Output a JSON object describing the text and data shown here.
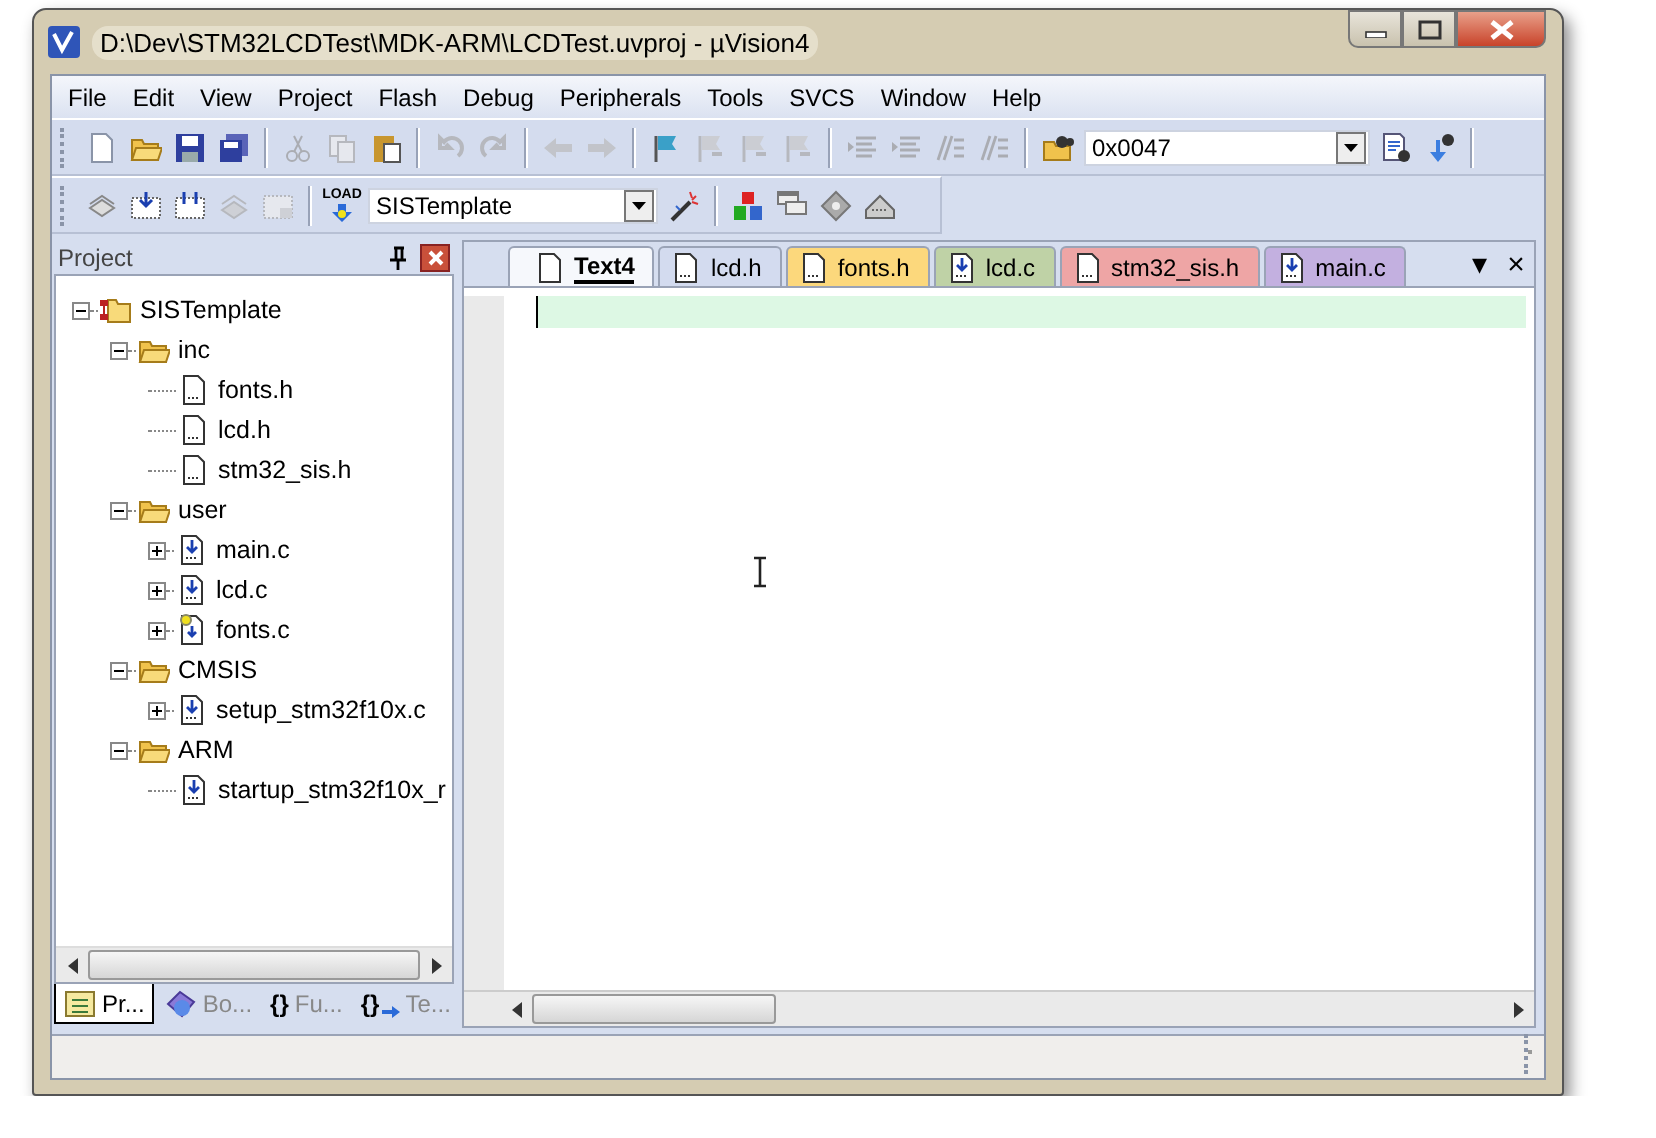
{
  "window": {
    "title": "D:\\Dev\\STM32LCDTest\\MDK-ARM\\LCDTest.uvproj - µVision4"
  },
  "menu": [
    "File",
    "Edit",
    "View",
    "Project",
    "Flash",
    "Debug",
    "Peripherals",
    "Tools",
    "SVCS",
    "Window",
    "Help"
  ],
  "toolbar_1": {
    "combo_value": "0x0047"
  },
  "toolbar_2": {
    "load_label": "LOAD",
    "combo_value": "SISTemplate"
  },
  "project_panel": {
    "title": "Project",
    "tree": [
      {
        "label": "SISTemplate",
        "kind": "project",
        "expanded": true,
        "children": [
          {
            "label": "inc",
            "kind": "group",
            "expanded": true,
            "children": [
              {
                "label": "fonts.h",
                "kind": "header"
              },
              {
                "label": "lcd.h",
                "kind": "header"
              },
              {
                "label": "stm32_sis.h",
                "kind": "header"
              }
            ]
          },
          {
            "label": "user",
            "kind": "group",
            "expanded": true,
            "children": [
              {
                "label": "main.c",
                "kind": "source",
                "expanded": false
              },
              {
                "label": "lcd.c",
                "kind": "source",
                "expanded": false
              },
              {
                "label": "fonts.c",
                "kind": "config",
                "expanded": false
              }
            ]
          },
          {
            "label": "CMSIS",
            "kind": "group",
            "expanded": true,
            "children": [
              {
                "label": "setup_stm32f10x.c",
                "kind": "source",
                "expanded": false
              }
            ]
          },
          {
            "label": "ARM",
            "kind": "group",
            "expanded": true,
            "children": [
              {
                "label": "startup_stm32f10x_r",
                "kind": "source"
              }
            ]
          }
        ]
      }
    ],
    "bottom_tabs": [
      {
        "label": "Pr...",
        "kind": "project",
        "selected": true
      },
      {
        "label": "Bo...",
        "kind": "books",
        "selected": false
      },
      {
        "label": "Fu...",
        "kind": "functions",
        "glyph": "{}",
        "selected": false
      },
      {
        "label": "Te...",
        "kind": "templates",
        "glyph": "{}",
        "selected": false
      }
    ]
  },
  "editor": {
    "tabs": [
      {
        "label": "Text4",
        "kind": "text",
        "color": "#f6f8fc",
        "selected": true
      },
      {
        "label": "lcd.h",
        "kind": "header",
        "color": "#d3dbef",
        "selected": false
      },
      {
        "label": "fonts.h",
        "kind": "header",
        "color": "#fcd87c",
        "selected": false
      },
      {
        "label": "lcd.c",
        "kind": "source",
        "color": "#bfd2a6",
        "selected": false
      },
      {
        "label": "stm32_sis.h",
        "kind": "header",
        "color": "#eea5a5",
        "selected": false
      },
      {
        "label": "main.c",
        "kind": "source",
        "color": "#c3b0e0",
        "selected": false
      }
    ],
    "tab_menu_glyph": "▾",
    "tab_close_glyph": "×"
  }
}
